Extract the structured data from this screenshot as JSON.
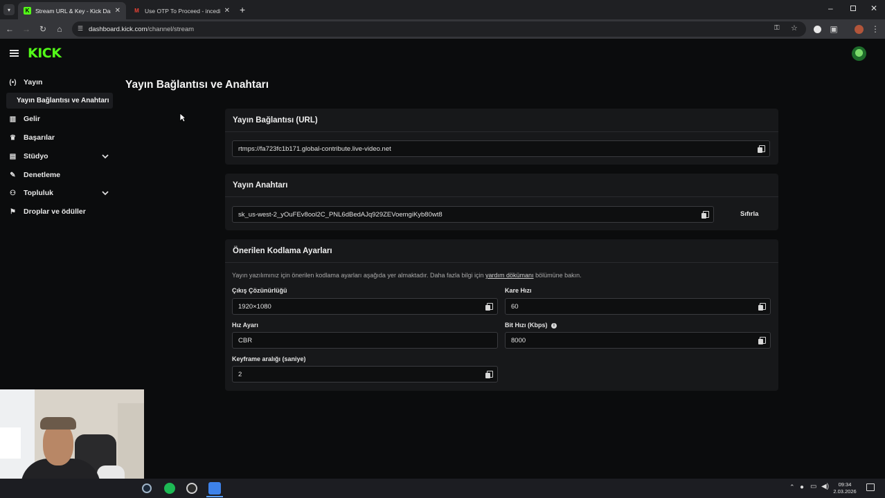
{
  "browser": {
    "tabs": [
      {
        "title": "Stream URL & Key - Kick Dashb",
        "favicon": "K",
        "active": true
      },
      {
        "title": "Use OTP To Proceed - incedi",
        "favicon": "M",
        "active": false
      }
    ],
    "url_host": "dashboard.kick.com",
    "url_path": "/channel/stream"
  },
  "brand": {
    "logo": "KICK",
    "accent": "#53fc18"
  },
  "sidebar": {
    "items": [
      {
        "label": "Yayın",
        "icon": "broadcast-icon"
      },
      {
        "label": "Yayın Bağlantısı ve Anahtarı",
        "icon": ""
      },
      {
        "label": "Gelir",
        "icon": "revenue-icon"
      },
      {
        "label": "Başarılar",
        "icon": "trophy-icon"
      },
      {
        "label": "Stüdyo",
        "icon": "studio-icon"
      },
      {
        "label": "Denetleme",
        "icon": "wrench-icon"
      },
      {
        "label": "Topluluk",
        "icon": "community-icon"
      },
      {
        "label": "Droplar ve ödüller",
        "icon": "drops-icon"
      }
    ]
  },
  "main": {
    "title": "Yayın Bağlantısı ve Anahtarı",
    "url_card": {
      "title": "Yayın Bağlantısı (URL)",
      "value": "rtmps://fa723fc1b171.global-contribute.live-video.net"
    },
    "key_card": {
      "title": "Yayın Anahtarı",
      "value": "sk_us-west-2_yOuFEv8ool2C_PNL6dBedAJq929ZEVoemgiKyb80wt8",
      "reset_label": "Sıfırla"
    },
    "encoding": {
      "title": "Önerilen Kodlama Ayarları",
      "desc_prefix": "Yayın yazılımınız için önerilen kodlama ayarları aşağıda yer almaktadır. Daha fazla bilgi için",
      "desc_link": "yardım dökümanı",
      "desc_suffix": "bölümüne bakın.",
      "fields": {
        "resolution": {
          "label": "Çıkış Çözünürlüğü",
          "value": "1920×1080"
        },
        "framerate": {
          "label": "Kare Hızı",
          "value": "60"
        },
        "rate_control": {
          "label": "Hız Ayarı",
          "value": "CBR"
        },
        "bitrate": {
          "label": "Bit Hızı (Kbps)",
          "value": "8000"
        },
        "keyframe": {
          "label": "Keyframe aralığı (saniye)",
          "value": "2"
        }
      }
    }
  },
  "taskbar": {
    "time": "09:34",
    "date": "2.03.2026"
  }
}
